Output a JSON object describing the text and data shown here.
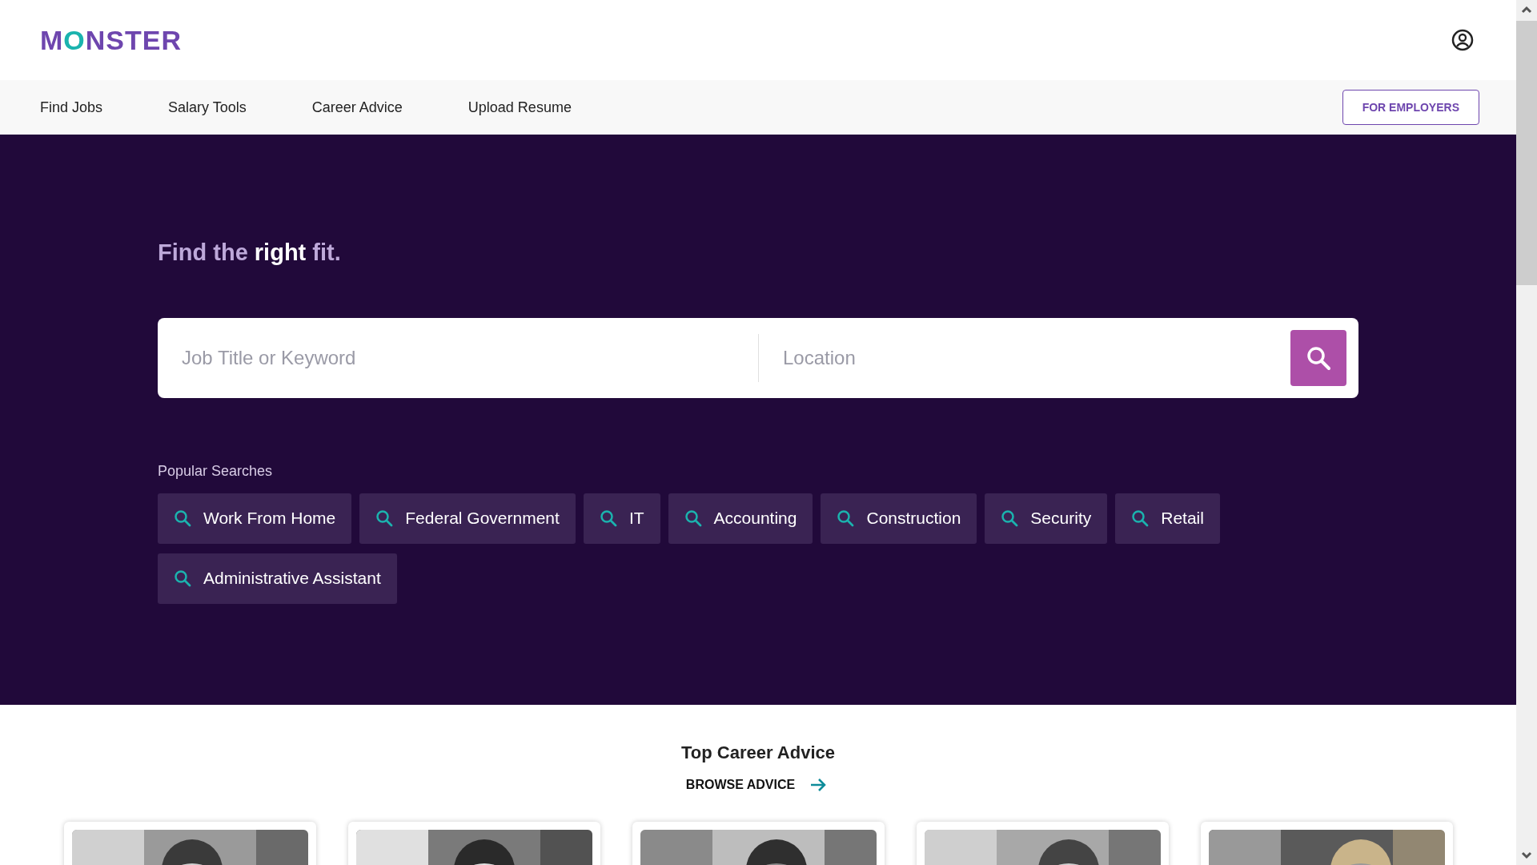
{
  "logo": {
    "before": "M",
    "accent": "O",
    "after": "NSTER"
  },
  "nav": {
    "items": [
      "Find Jobs",
      "Salary Tools",
      "Career Advice",
      "Upload Resume"
    ],
    "employers_button": "FOR EMPLOYERS"
  },
  "hero": {
    "heading": "Find the **right** fit.",
    "keyword_field": {
      "placeholder": "Job Title or Keyword"
    },
    "location_field": {
      "placeholder": "Location"
    },
    "popular_label": "Popular Searches",
    "popular_searches": [
      "Work From Home",
      "Federal Government",
      "IT",
      "Accounting",
      "Construction",
      "Security",
      "Retail",
      "Administrative Assistant"
    ]
  },
  "career_advice": {
    "title": "Top Career Advice",
    "browse_link": "BROWSE ADVICE"
  }
}
